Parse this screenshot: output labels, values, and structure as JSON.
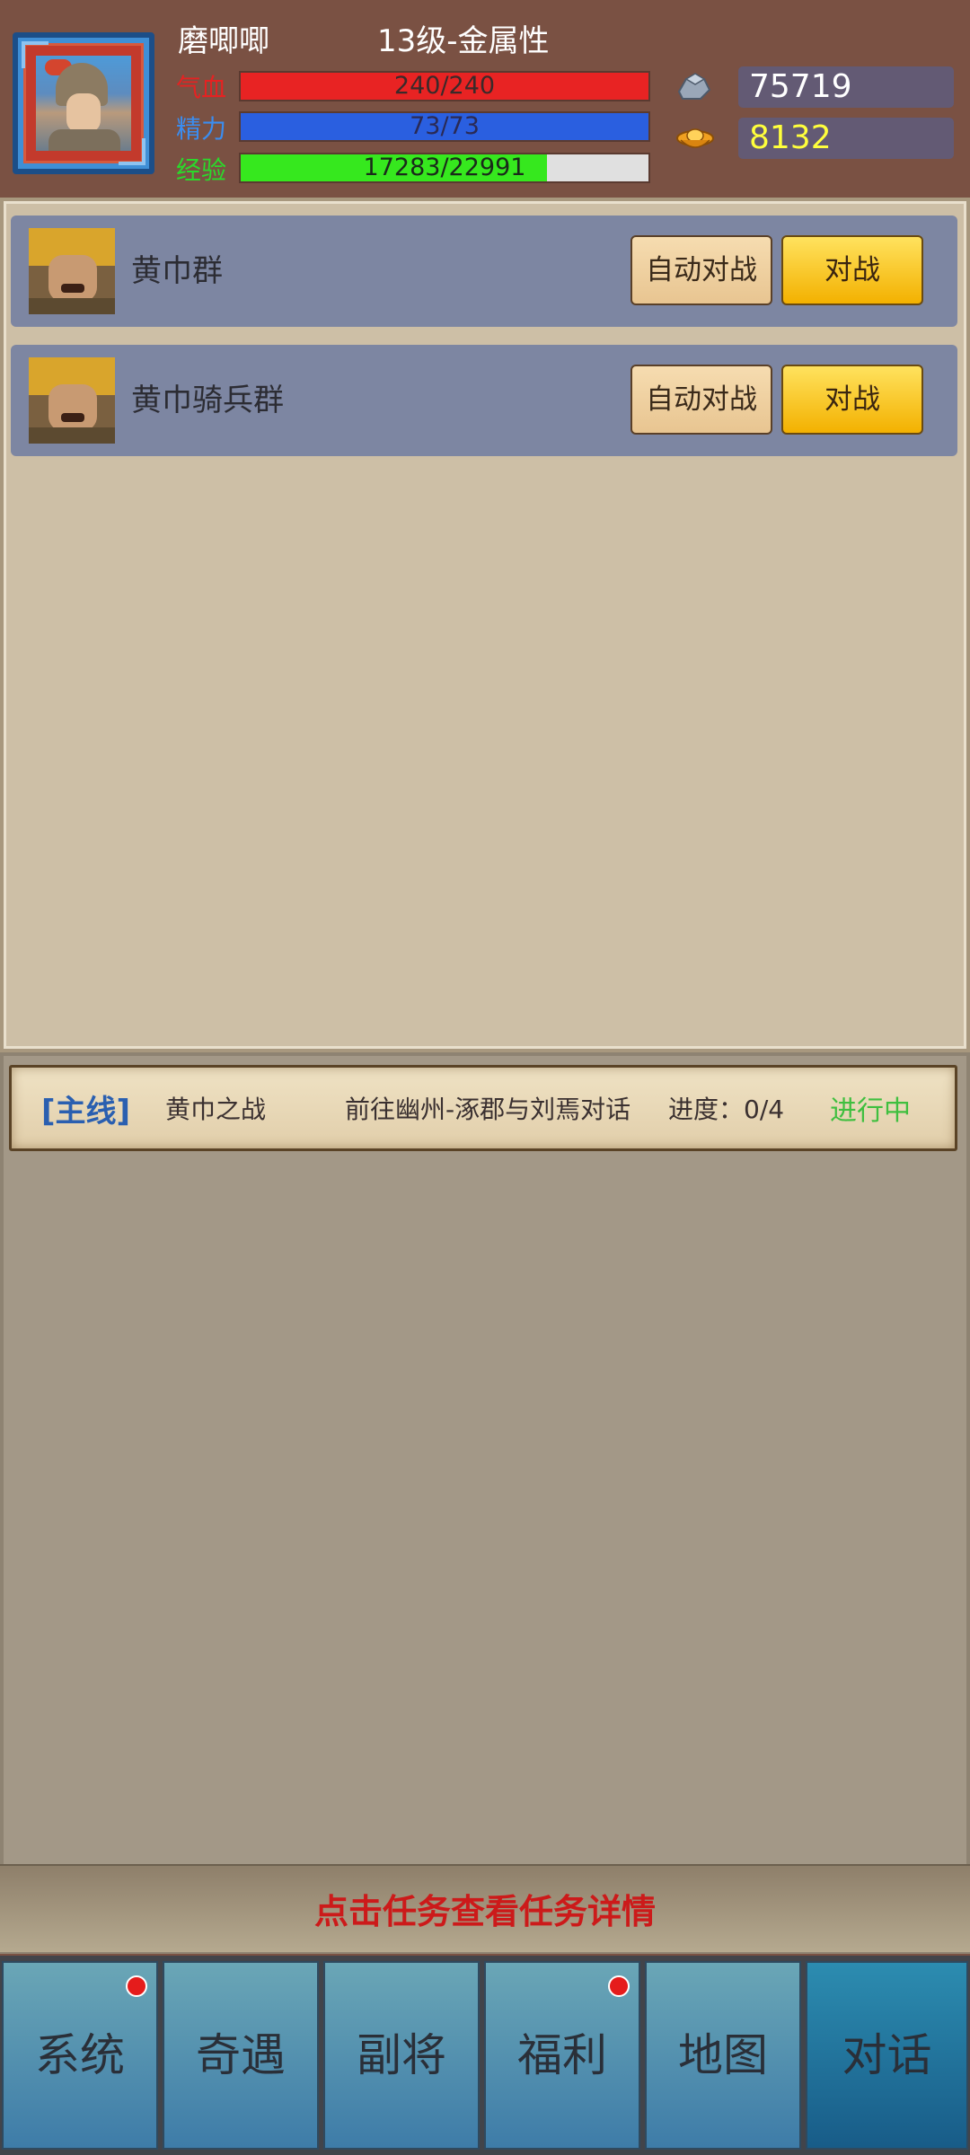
{
  "player": {
    "name": "磨唧唧",
    "level": "13级-金属性",
    "hp": {
      "label": "气血",
      "text": "240/240",
      "fraction": 1.0
    },
    "mp": {
      "label": "精力",
      "text": "73/73",
      "fraction": 1.0
    },
    "xp": {
      "label": "经验",
      "text": "17283/22991",
      "fraction": 0.7517
    }
  },
  "currency": {
    "silver": {
      "icon": "silver-ingot-icon",
      "value": "75719"
    },
    "gold": {
      "icon": "gold-ingot-icon",
      "value": "8132"
    }
  },
  "enemies": [
    {
      "name": "黄巾群",
      "auto_label": "自动对战",
      "battle_label": "对战"
    },
    {
      "name": "黄巾骑兵群",
      "auto_label": "自动对战",
      "battle_label": "对战"
    }
  ],
  "quest": {
    "type": "[主线]",
    "name": "黄巾之战",
    "description": "前往幽州-涿郡与刘焉对话",
    "progress": "进度：0/4",
    "status": "进行中"
  },
  "hint": "点击任务查看任务详情",
  "nav": [
    {
      "label": "系统",
      "badge": true
    },
    {
      "label": "奇遇",
      "badge": false
    },
    {
      "label": "副将",
      "badge": false
    },
    {
      "label": "福利",
      "badge": true
    },
    {
      "label": "地图",
      "badge": false
    },
    {
      "label": "对话",
      "badge": false,
      "active": true
    }
  ],
  "colors": {
    "header_bg": "#7a5143",
    "hp": "#e82323",
    "mp": "#2a5fe0",
    "xp": "#36e81e",
    "quest_status": "#3fbf3f",
    "hint": "#cc1a1a"
  }
}
